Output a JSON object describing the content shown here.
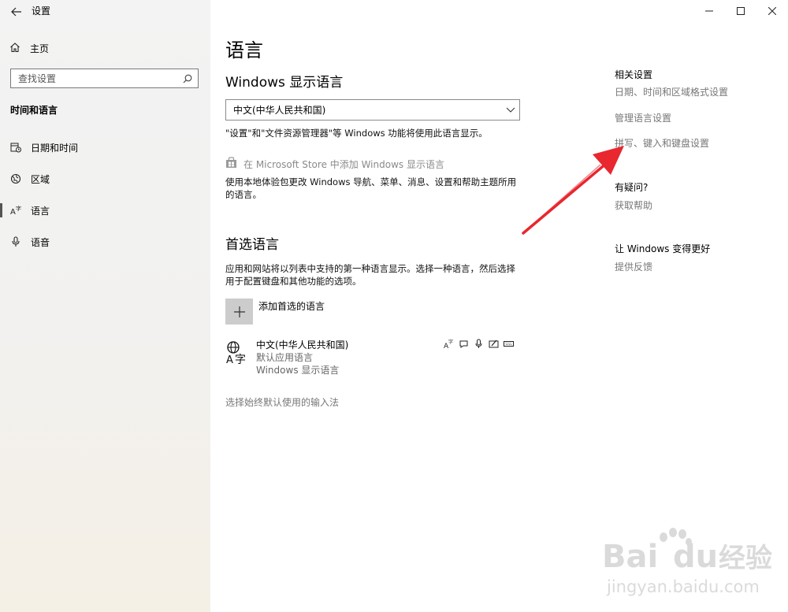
{
  "window": {
    "title": "设置",
    "controls": [
      "minimize",
      "maximize",
      "close"
    ]
  },
  "sidebar": {
    "home_label": "主页",
    "search_placeholder": "查找设置",
    "section_heading": "时间和语言",
    "items": [
      {
        "label": "日期和时间",
        "icon": "clock-calendar-icon"
      },
      {
        "label": "区域",
        "icon": "globe-icon"
      },
      {
        "label": "语言",
        "icon": "language-icon",
        "active": true
      },
      {
        "label": "语音",
        "icon": "microphone-icon"
      }
    ]
  },
  "main": {
    "page_title": "语言",
    "display_language": {
      "heading": "Windows 显示语言",
      "selected": "中文(中华人民共和国)",
      "description": "\"设置\"和\"文件资源管理器\"等 Windows 功能将使用此语言显示。",
      "store_link": "在 Microsoft Store 中添加 Windows 显示语言",
      "store_description_line1": "使用本地体验包更改 Windows 导航、菜单、消息、设置和帮助主题所用",
      "store_description_line2": "的语言。"
    },
    "preferred": {
      "heading": "首选语言",
      "description_line1": "应用和网站将以列表中支持的第一种语言显示。选择一种语言，然后选择",
      "description_line2": "用于配置键盘和其他功能的选项。",
      "add_label": "添加首选的语言",
      "languages": [
        {
          "name": "中文(中华人民共和国)",
          "sub1": "默认应用语言",
          "sub2": "Windows 显示语言",
          "features": [
            "language-pack-icon",
            "speech-icon",
            "microphone-icon",
            "handwriting-icon",
            "keyboard-icon"
          ]
        }
      ],
      "input_method_link": "选择始终默认使用的输入法"
    }
  },
  "related": {
    "heading": "相关设置",
    "links": [
      "日期、时间和区域格式设置",
      "管理语言设置",
      "拼写、键入和键盘设置"
    ],
    "help_heading": "有疑问?",
    "help_link": "获取帮助",
    "feedback_heading": "让 Windows 变得更好",
    "feedback_link": "提供反馈"
  },
  "annotation": {
    "arrow_color": "#e8272f"
  },
  "watermark": {
    "brand": "Bai",
    "brand2": "du",
    "label": "经验",
    "url": "jingyan.baidu.com"
  }
}
